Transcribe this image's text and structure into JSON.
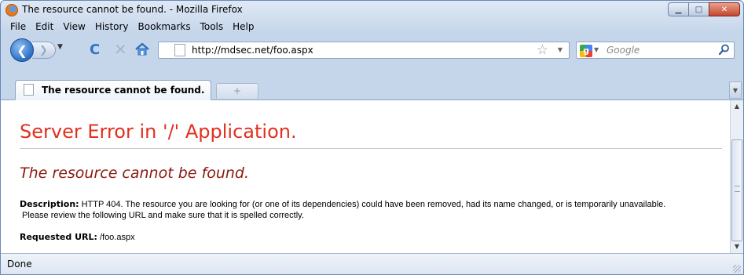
{
  "window": {
    "title": "The resource cannot be found. - Mozilla Firefox",
    "minimize_label": "▁",
    "maximize_label": "□",
    "close_label": "✕"
  },
  "menubar": {
    "items": [
      "File",
      "Edit",
      "View",
      "History",
      "Bookmarks",
      "Tools",
      "Help"
    ]
  },
  "navbar": {
    "back_glyph": "❮",
    "forward_glyph": "❯",
    "dropdown_glyph": "▼",
    "reload_glyph": "C",
    "stop_glyph": "✕",
    "url": "http://mdsec.net/foo.aspx",
    "star_glyph": "☆",
    "url_dropdown_glyph": "▼",
    "search_placeholder": "Google",
    "search_engine_glyph": "g",
    "search_dropdown_glyph": "▼"
  },
  "tabs": {
    "items": [
      {
        "label": "The resource cannot be found."
      }
    ],
    "new_tab_glyph": "+",
    "list_tabs_glyph": "▼"
  },
  "page": {
    "title": "Server Error in '/' Application.",
    "subtitle": "The resource cannot be found.",
    "description_label": "Description:",
    "description_text": "HTTP 404. The resource you are looking for (or one of its dependencies) could have been removed, had its name changed, or is temporarily unavailable.",
    "description_text2": "Please review the following URL and make sure that it is spelled correctly.",
    "requested_url_label": "Requested URL:",
    "requested_url_value": "/foo.aspx"
  },
  "scrollbar": {
    "up_glyph": "▲",
    "down_glyph": "▼"
  },
  "status": {
    "text": "Done"
  },
  "colors": {
    "error_title": "#e0311f",
    "error_subtitle": "#8a1a10",
    "chrome_blue": "#c6d6ea"
  }
}
